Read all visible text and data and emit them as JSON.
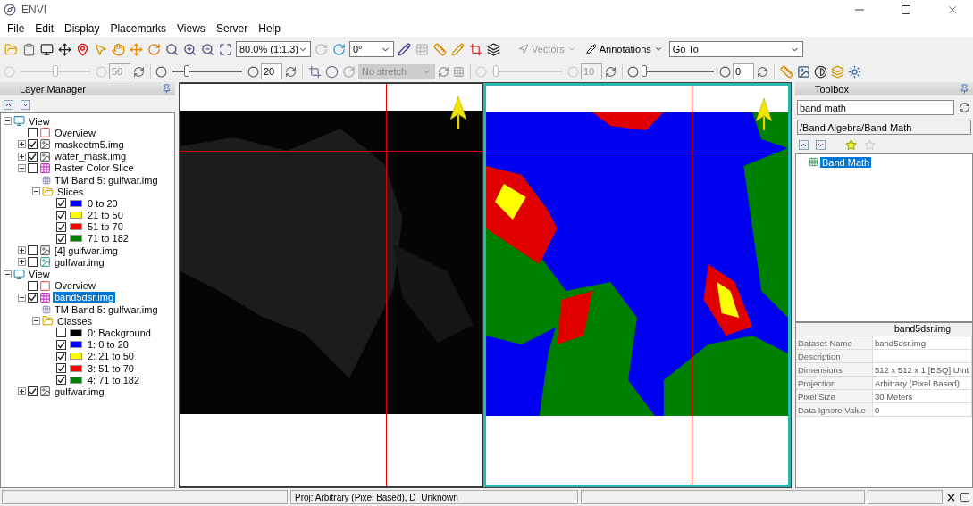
{
  "window": {
    "title": "ENVI"
  },
  "menu": [
    "File",
    "Edit",
    "Display",
    "Placemarks",
    "Views",
    "Server",
    "Help"
  ],
  "toolbar": {
    "zoom": "80.0% (1:1.3)",
    "rotation": "0°",
    "vectors": {
      "label": "Vectors",
      "disabled": true
    },
    "annotations": {
      "label": "Annotations",
      "disabled": false
    },
    "go_to": "Go To"
  },
  "sliders": [
    {
      "level": 0.5,
      "disabled": true,
      "value": "50"
    },
    {
      "level": 0.2,
      "disabled": false,
      "value": "20"
    },
    {
      "level": 0.05,
      "disabled": true,
      "value": "10"
    },
    {
      "level": 0,
      "disabled": false,
      "value": "0"
    }
  ],
  "stretch": {
    "value": "No stretch",
    "disabled": true
  },
  "layer_manager": {
    "title": "Layer Manager",
    "layers": [
      {
        "kind": "view",
        "label": "View",
        "expanded": true,
        "selected": false,
        "children": [
          {
            "kind": "overview",
            "label": "Overview",
            "checked": false,
            "selected": false
          },
          {
            "kind": "raster",
            "label": "maskedtm5.img",
            "checked": true,
            "expanded": false,
            "selected": false
          },
          {
            "kind": "raster",
            "label": "water_mask.img",
            "checked": true,
            "expanded": false,
            "selected": false
          },
          {
            "kind": "colorslice",
            "label": "Raster Color Slice",
            "checked": false,
            "expanded": true,
            "selected": false,
            "children": [
              {
                "kind": "band",
                "label": "TM Band 5: gulfwar.img",
                "selected": false
              },
              {
                "kind": "folder",
                "label": "Slices",
                "expanded": true,
                "selected": false,
                "children": [
                  {
                    "kind": "slice",
                    "label": "0 to 20",
                    "checked": true,
                    "color": "#0000ff",
                    "selected": false
                  },
                  {
                    "kind": "slice",
                    "label": "21 to 50",
                    "checked": true,
                    "color": "#ffff00",
                    "selected": false
                  },
                  {
                    "kind": "slice",
                    "label": "51 to 70",
                    "checked": true,
                    "color": "#ff0000",
                    "selected": false
                  },
                  {
                    "kind": "slice",
                    "label": "71 to 182",
                    "checked": true,
                    "color": "#008000",
                    "selected": false
                  }
                ]
              }
            ]
          },
          {
            "kind": "raster",
            "label": "[4] gulfwar.img",
            "checked": false,
            "expanded": false,
            "selected": false
          },
          {
            "kind": "rgb",
            "label": "gulfwar.img",
            "checked": false,
            "expanded": false,
            "selected": false
          }
        ]
      },
      {
        "kind": "view",
        "label": "View",
        "expanded": true,
        "selected": false,
        "children": [
          {
            "kind": "overview",
            "label": "Overview",
            "checked": false,
            "selected": false
          },
          {
            "kind": "colorslice",
            "label": "band5dsr.img",
            "checked": true,
            "expanded": true,
            "selected": true,
            "children": [
              {
                "kind": "band",
                "label": "TM Band 5: gulfwar.img",
                "selected": false
              },
              {
                "kind": "folder",
                "label": "Classes",
                "expanded": true,
                "selected": false,
                "children": [
                  {
                    "kind": "slice",
                    "label": "0: Background",
                    "checked": false,
                    "color": "#000000",
                    "selected": false
                  },
                  {
                    "kind": "slice",
                    "label": "1: 0 to 20",
                    "checked": true,
                    "color": "#0000ff",
                    "selected": false
                  },
                  {
                    "kind": "slice",
                    "label": "2: 21 to 50",
                    "checked": true,
                    "color": "#ffff00",
                    "selected": false
                  },
                  {
                    "kind": "slice",
                    "label": "3: 51 to 70",
                    "checked": true,
                    "color": "#ff0000",
                    "selected": false
                  },
                  {
                    "kind": "slice",
                    "label": "4: 71 to 182",
                    "checked": true,
                    "color": "#008000",
                    "selected": false
                  }
                ]
              }
            ]
          },
          {
            "kind": "raster",
            "label": "gulfwar.img",
            "checked": true,
            "expanded": false,
            "selected": false
          }
        ]
      }
    ]
  },
  "views": [
    {
      "kind": "grayscale",
      "selected": false
    },
    {
      "kind": "classified",
      "selected": true
    }
  ],
  "toolbox": {
    "title": "Toolbox",
    "search": "band math",
    "path": "/Band Algebra/Band Math",
    "items": [
      {
        "label": "Band Math",
        "selected": true
      }
    ],
    "properties": {
      "header": "band5dsr.img",
      "rows": [
        {
          "name": "Dataset Name",
          "value": "band5dsr.img"
        },
        {
          "name": "Description"
        },
        {
          "name": "Dimensions",
          "value": "512 x 512 x 1 [BSQ] UInt"
        },
        {
          "name": "Projection",
          "value": "Arbitrary (Pixel Based)"
        },
        {
          "name": "Pixel Size",
          "value": "30 Meters"
        },
        {
          "name": "Data Ignore Value",
          "value": "0"
        }
      ]
    }
  },
  "status_bar": {
    "projection": "Proj: Arbitrary (Pixel Based), D_Unknown"
  }
}
